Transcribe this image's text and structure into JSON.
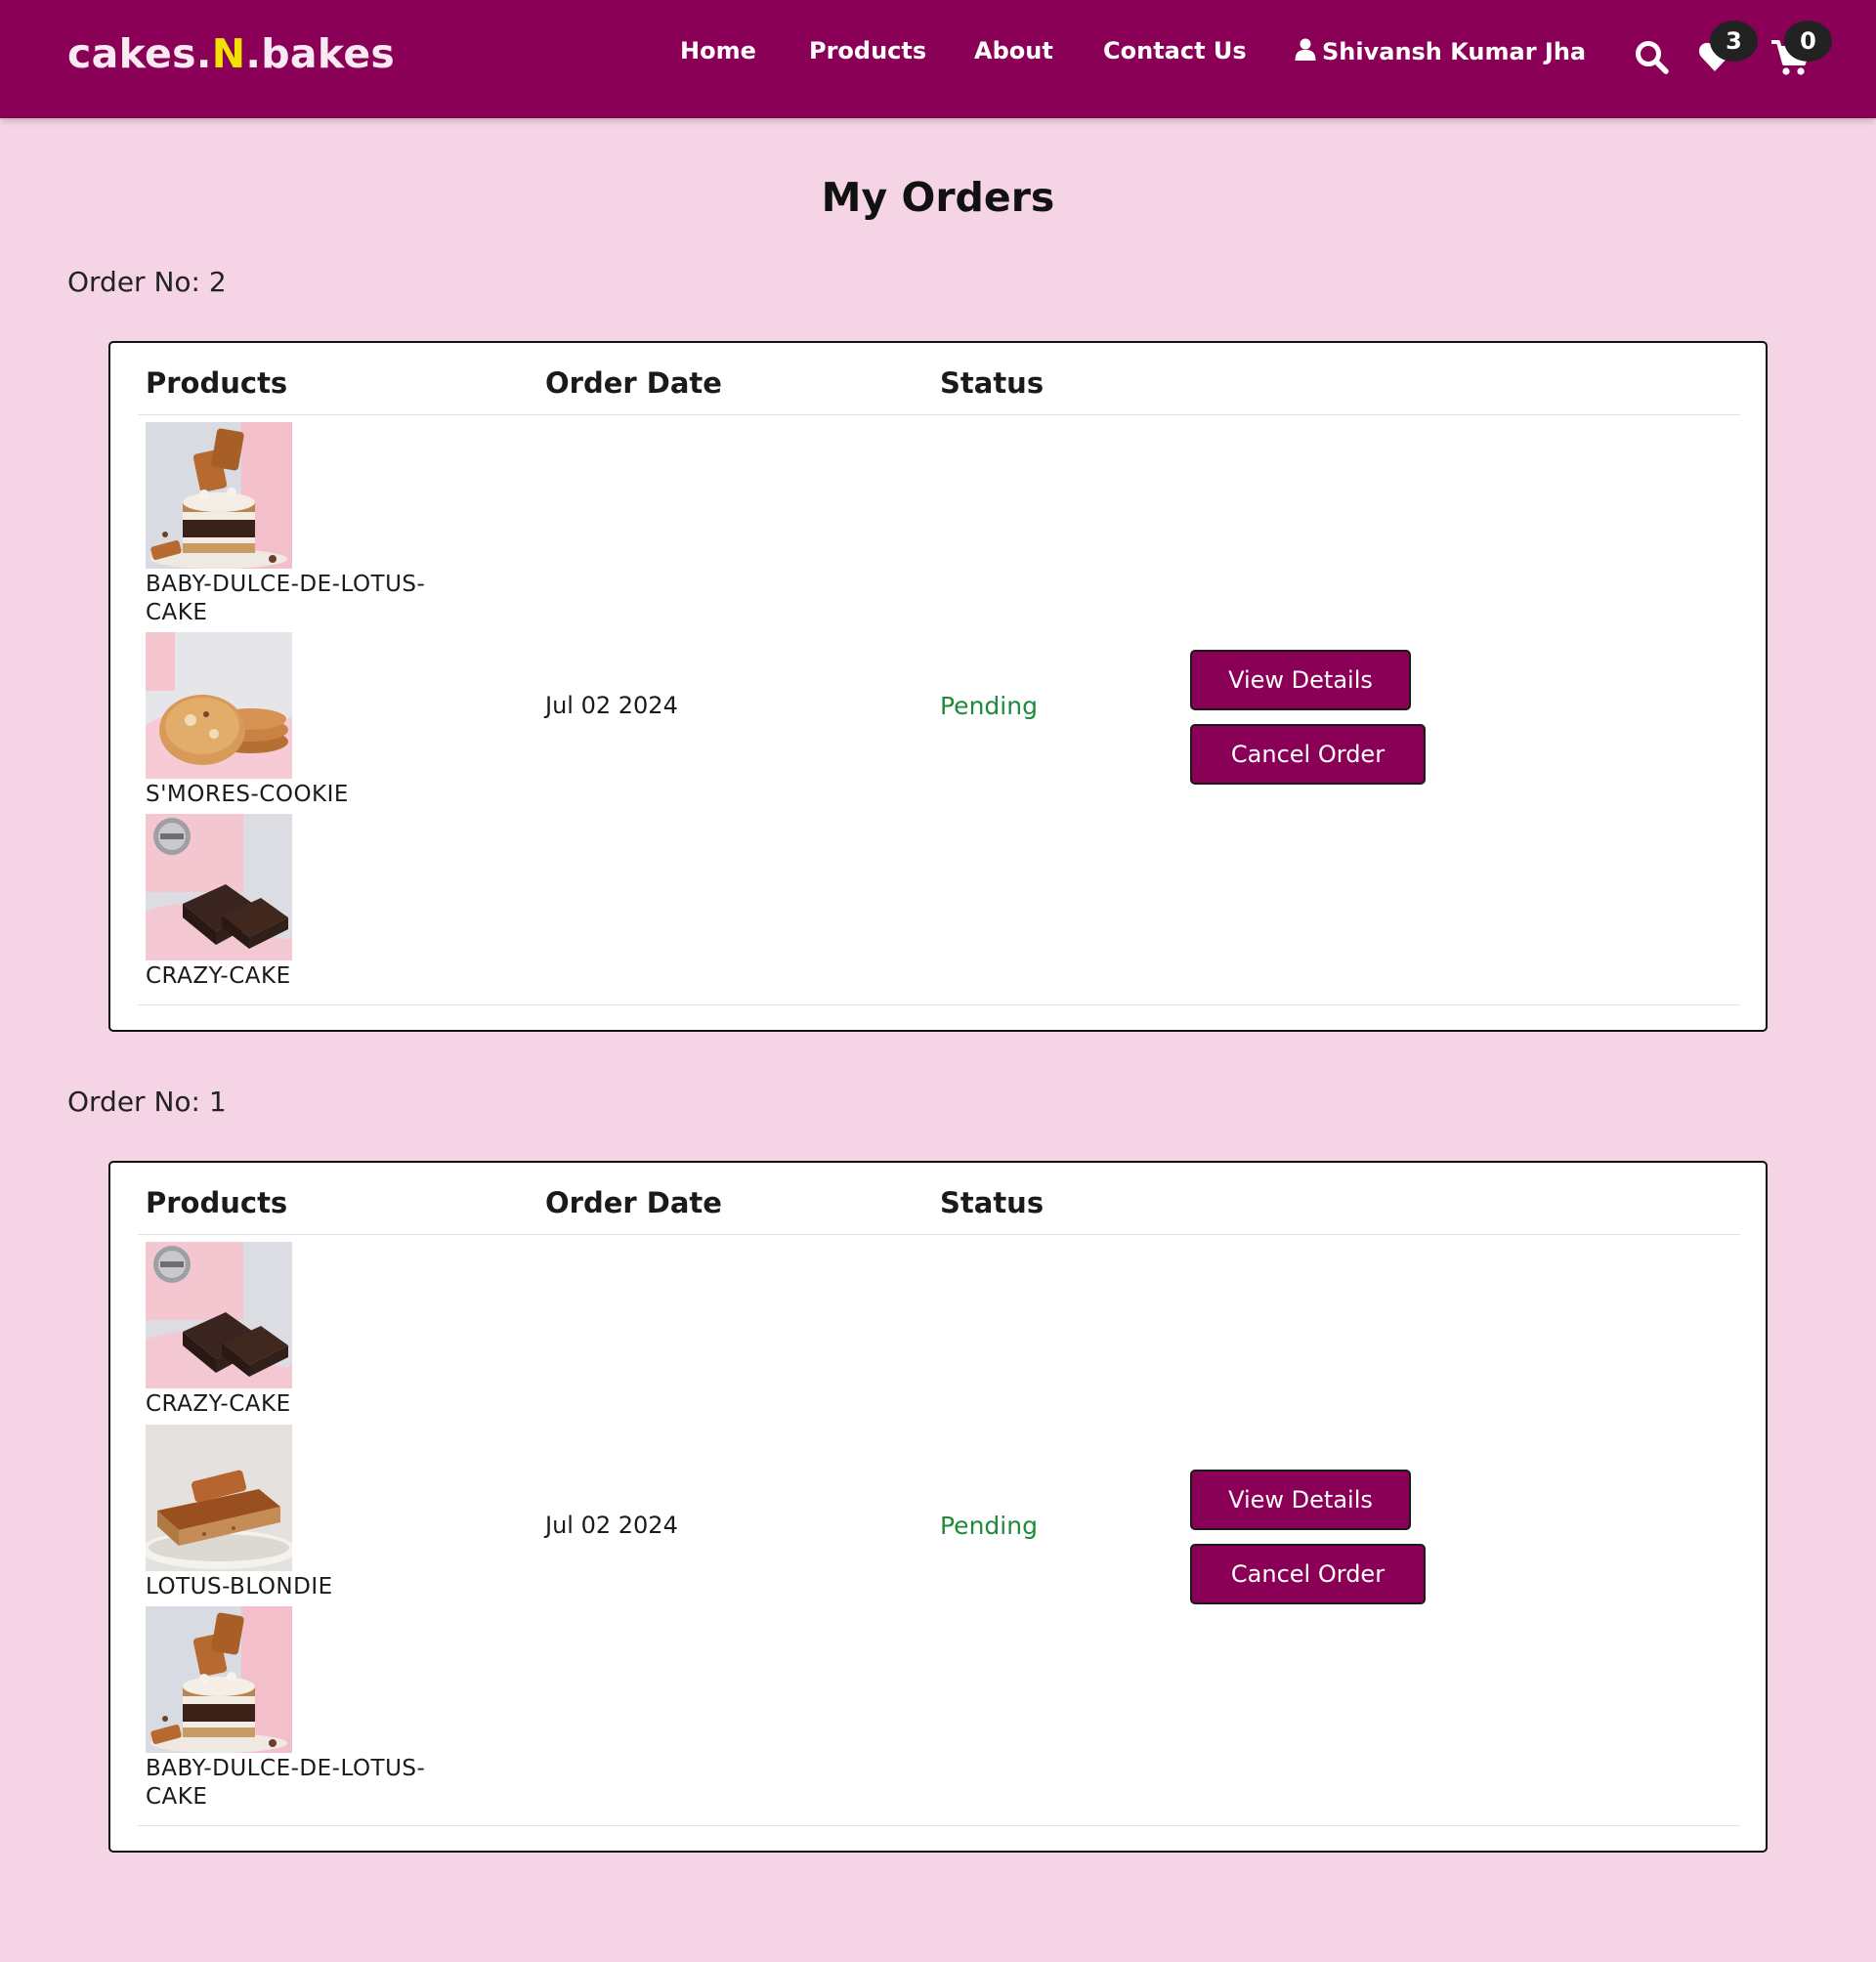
{
  "brand": {
    "part1": "cakes.",
    "accent": "N",
    "part2": ".bakes"
  },
  "nav": {
    "home": "Home",
    "products": "Products",
    "about": "About",
    "contact": "Contact Us",
    "user_name": "Shivansh Kumar Jha",
    "wishlist_count": "3",
    "cart_count": "0"
  },
  "page": {
    "title": "My Orders"
  },
  "table_headers": {
    "products": "Products",
    "order_date": "Order Date",
    "status": "Status"
  },
  "colors": {
    "brand": "#8b0057",
    "accent": "#f4e104",
    "page_bg": "#f5d5e5",
    "status_pending": "#1e8a3c"
  },
  "orders": [
    {
      "heading": "Order No: 2",
      "products": [
        {
          "name": "BABY-DULCE-DE-LOTUS-CAKE",
          "image": "layered-cake-image"
        },
        {
          "name": "S'MORES-COOKIE",
          "image": "cookies-image"
        },
        {
          "name": "CRAZY-CAKE",
          "image": "brownie-image"
        }
      ],
      "date": "Jul 02 2024",
      "status": "Pending",
      "view_label": "View Details",
      "cancel_label": "Cancel Order"
    },
    {
      "heading": "Order No: 1",
      "products": [
        {
          "name": "CRAZY-CAKE",
          "image": "brownie-image"
        },
        {
          "name": "LOTUS-BLONDIE",
          "image": "blondie-image"
        },
        {
          "name": "BABY-DULCE-DE-LOTUS-CAKE",
          "image": "layered-cake-image"
        }
      ],
      "date": "Jul 02 2024",
      "status": "Pending",
      "view_label": "View Details",
      "cancel_label": "Cancel Order"
    }
  ]
}
